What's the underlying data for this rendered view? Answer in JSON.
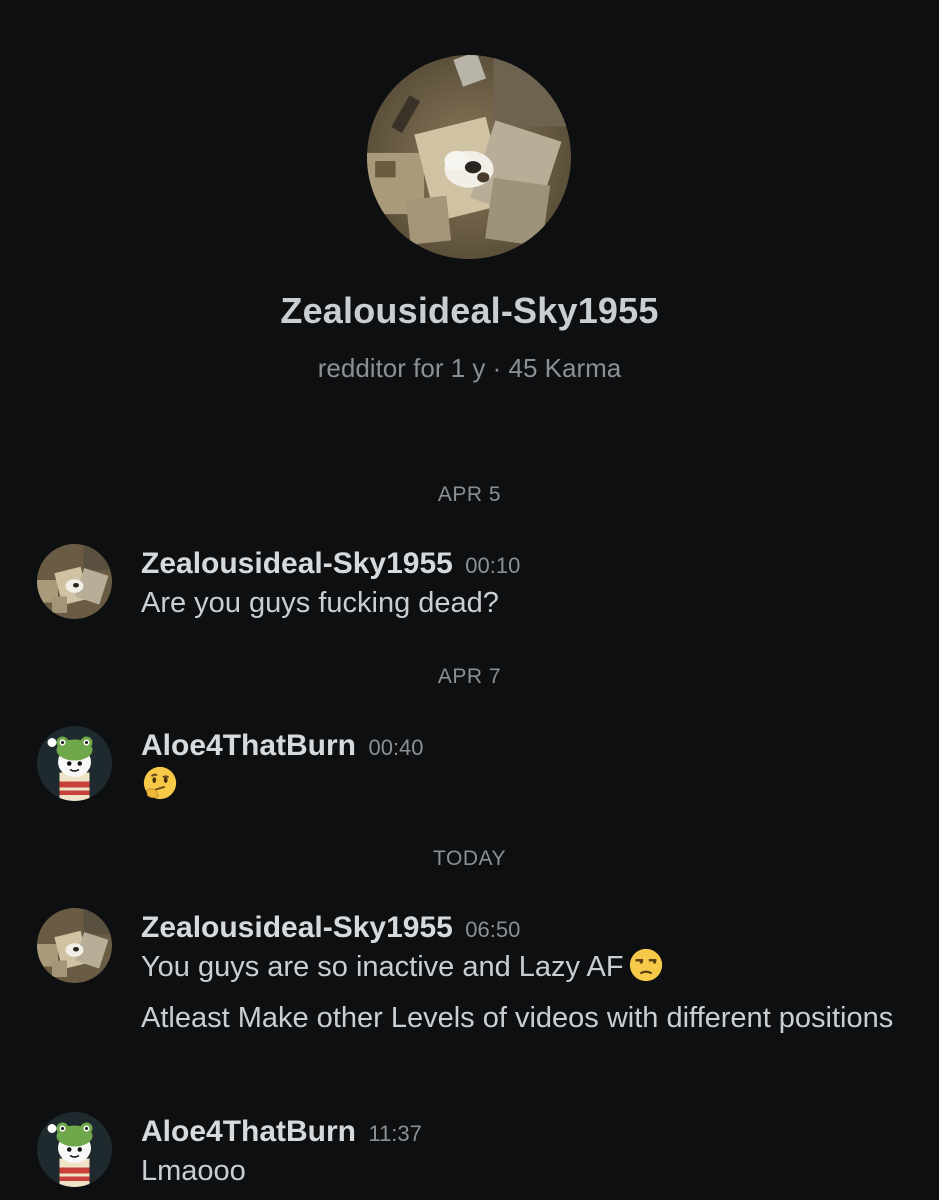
{
  "profile": {
    "username": "Zealousideal-Sky1955",
    "meta": "redditor for 1 y · 45 Karma"
  },
  "separators": {
    "apr5": "APR 5",
    "apr7": "APR 7",
    "today": "TODAY"
  },
  "messages": [
    {
      "author": "Zealousideal-Sky1955",
      "time": "00:10",
      "text": "Are you guys fucking dead?"
    },
    {
      "author": "Aloe4ThatBurn",
      "time": "00:40",
      "emoji": "thinking-face"
    },
    {
      "author": "Zealousideal-Sky1955",
      "time": "06:50",
      "text": "You guys are so inactive and Lazy AF",
      "emoji": "unamused-face",
      "text2": "Atleast Make other Levels of videos with different positions"
    },
    {
      "author": "Aloe4ThatBurn",
      "time": "11:37",
      "text": "Lmaooo"
    }
  ],
  "colors": {
    "background": "#0e0f11",
    "primary_text": "#d7dadc",
    "secondary_text": "#8b9094"
  }
}
